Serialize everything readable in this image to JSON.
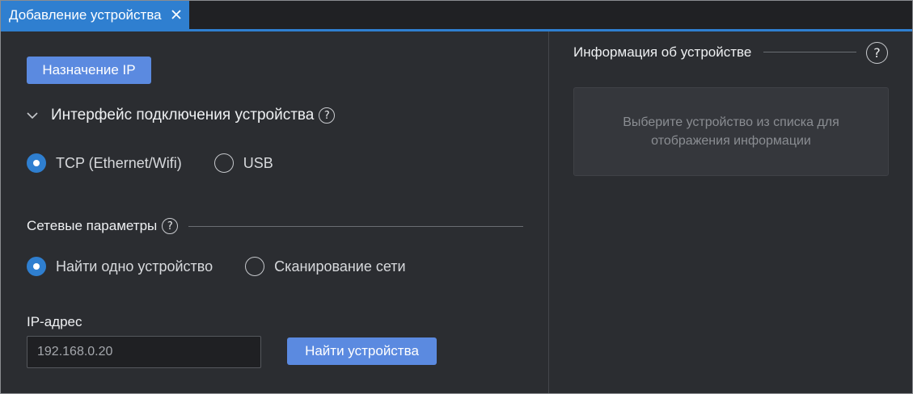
{
  "tab": {
    "title": "Добавление устройства",
    "close_icon": "close-icon"
  },
  "left": {
    "ip_assign_label": "Назначение IP",
    "interface_section": {
      "title": "Интерфейс подключения устройства",
      "help": "?",
      "options": [
        {
          "label": "TCP (Ethernet/Wifi)",
          "selected": true
        },
        {
          "label": "USB",
          "selected": false
        }
      ]
    },
    "network_section": {
      "title": "Сетевые параметры",
      "help": "?",
      "options": [
        {
          "label": "Найти одно устройство",
          "selected": true
        },
        {
          "label": "Сканирование сети",
          "selected": false
        }
      ]
    },
    "ip_field": {
      "label": "IP-адрес",
      "value": "192.168.0.20"
    },
    "find_button_label": "Найти устройства"
  },
  "right": {
    "title": "Информация об устройстве",
    "help": "?",
    "placeholder": "Выберите устройство из списка для отображения информации"
  },
  "colors": {
    "accent": "#2f7fd0",
    "button": "#5b8ae0",
    "background": "#2b2d31"
  }
}
